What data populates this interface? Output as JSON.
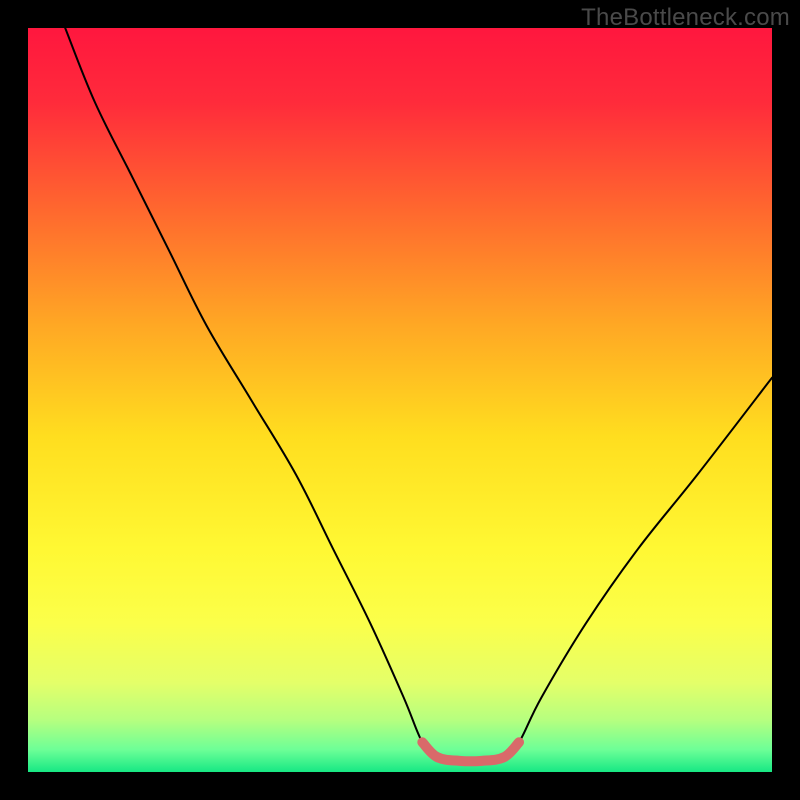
{
  "watermark": "TheBottleneck.com",
  "chart_data": {
    "type": "line",
    "title": "",
    "xlabel": "",
    "ylabel": "",
    "xlim": [
      0,
      100
    ],
    "ylim": [
      0,
      100
    ],
    "gradient_stops": [
      {
        "offset": 0.0,
        "color": "#ff173e"
      },
      {
        "offset": 0.1,
        "color": "#ff2b3b"
      },
      {
        "offset": 0.25,
        "color": "#ff6a2e"
      },
      {
        "offset": 0.4,
        "color": "#ffa824"
      },
      {
        "offset": 0.55,
        "color": "#ffde1f"
      },
      {
        "offset": 0.7,
        "color": "#fff833"
      },
      {
        "offset": 0.8,
        "color": "#fbff4a"
      },
      {
        "offset": 0.88,
        "color": "#e4ff69"
      },
      {
        "offset": 0.93,
        "color": "#b6ff7f"
      },
      {
        "offset": 0.97,
        "color": "#6dff97"
      },
      {
        "offset": 1.0,
        "color": "#17e884"
      }
    ],
    "series": [
      {
        "name": "bottleneck-curve",
        "color": "#000000",
        "points": [
          {
            "x": 5.0,
            "y": 100.0
          },
          {
            "x": 9.0,
            "y": 90.0
          },
          {
            "x": 14.0,
            "y": 80.0
          },
          {
            "x": 19.0,
            "y": 70.0
          },
          {
            "x": 24.0,
            "y": 60.0
          },
          {
            "x": 30.0,
            "y": 50.0
          },
          {
            "x": 36.0,
            "y": 40.0
          },
          {
            "x": 41.0,
            "y": 30.0
          },
          {
            "x": 46.0,
            "y": 20.0
          },
          {
            "x": 50.5,
            "y": 10.0
          },
          {
            "x": 53.0,
            "y": 4.0
          },
          {
            "x": 55.0,
            "y": 2.0
          },
          {
            "x": 58.0,
            "y": 1.5
          },
          {
            "x": 61.0,
            "y": 1.5
          },
          {
            "x": 64.0,
            "y": 2.0
          },
          {
            "x": 66.0,
            "y": 4.0
          },
          {
            "x": 69.0,
            "y": 10.0
          },
          {
            "x": 75.0,
            "y": 20.0
          },
          {
            "x": 82.0,
            "y": 30.0
          },
          {
            "x": 90.0,
            "y": 40.0
          },
          {
            "x": 100.0,
            "y": 53.0
          }
        ]
      },
      {
        "name": "optimal-range-highlight",
        "color": "#d96a6a",
        "points": [
          {
            "x": 53.0,
            "y": 4.0
          },
          {
            "x": 55.0,
            "y": 2.0
          },
          {
            "x": 58.0,
            "y": 1.5
          },
          {
            "x": 61.0,
            "y": 1.5
          },
          {
            "x": 64.0,
            "y": 2.0
          },
          {
            "x": 66.0,
            "y": 4.0
          }
        ]
      }
    ]
  }
}
